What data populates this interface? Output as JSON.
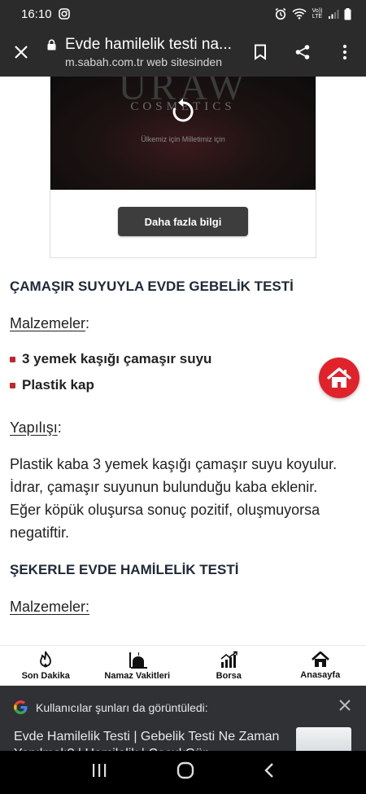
{
  "status_bar": {
    "time": "16:10",
    "network_label": "Vo)) LTE"
  },
  "toolbar": {
    "page_title": "Evde hamilelik testi na...",
    "page_subtitle": "m.sabah.com.tr web sitesinden"
  },
  "ad": {
    "brand_text": "URAW",
    "brand_subtext": "COSMETICS",
    "slogan": "Ülkemiz için  Milletimiz için",
    "cta_label": "Daha fazla bilgi"
  },
  "article": {
    "section1_title": "ÇAMAŞIR SUYUYLA EVDE GEBELİK TESTİ",
    "materials_label": "Malzemeler",
    "materials_colon": ":",
    "materials": [
      "3 yemek kaşığı çamaşır suyu",
      "Plastik kap"
    ],
    "method_label": "Yapılışı",
    "method_colon": ":",
    "method_text": "Plastik kaba 3 yemek kaşığı çamaşır suyu koyulur. İdrar, çamaşır suyunun bulunduğu kaba eklenir. Eğer köpük oluşursa sonuç pozitif, oluşmuyorsa negatiftir.",
    "section2_title": "ŞEKERLE EVDE HAMİLELİK TESTİ",
    "section2_materials_label": "Malzemeler:"
  },
  "bottom_nav": {
    "items": [
      {
        "label": "Son Dakika",
        "icon": "flame-icon"
      },
      {
        "label": "Namaz Vakitleri",
        "icon": "mosque-icon"
      },
      {
        "label": "Borsa",
        "icon": "chart-icon"
      },
      {
        "label": "Anasayfa",
        "icon": "home-icon"
      }
    ]
  },
  "related_panel": {
    "header": "Kullanıcılar şunları da görüntüledi:",
    "item_title": "Evde Hamilelik Testi | Gebelik Testi Ne Zaman Yapılmalı? | Hamilelik | CocukGün"
  },
  "colors": {
    "accent_red": "#e0232b",
    "bullet_red": "#c0272d",
    "toolbar_bg": "#2b2b2b",
    "button_dark": "#3d3d3d"
  }
}
